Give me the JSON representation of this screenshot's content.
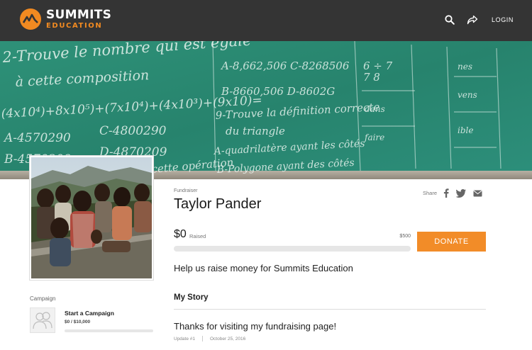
{
  "header": {
    "logo_line1": "SUMMITS",
    "logo_line2": "EDUCATION",
    "login_label": "LOGIN",
    "icons": [
      "search-icon",
      "share-arrow-icon"
    ]
  },
  "colors": {
    "nav_bg": "#343434",
    "brand_orange": "#f18a21",
    "donate_button": "#f28c28",
    "hero_chalkboard": "#2a8a73"
  },
  "hero": {
    "image": "chalkboard with handwritten French math text"
  },
  "sidebar": {
    "section_label": "Campaign",
    "campaign_title": "Start a Campaign",
    "campaign_amount": "$0 / $10,000",
    "campaign_progress": 0
  },
  "fundraiser": {
    "type_label": "Fundraiser",
    "name": "Taylor Pander",
    "share_label": "Share",
    "share_icons": [
      "facebook-icon",
      "twitter-icon",
      "email-icon"
    ],
    "raised_amount": "$0",
    "raised_label": "Raised",
    "goal": "$500",
    "progress": 0,
    "donate_label": "DONATE",
    "tagline": "Help us raise money for Summits Education"
  },
  "story": {
    "heading": "My Story",
    "update_title": "Thanks for visiting my fundraising page!",
    "update_number": "Update #1",
    "update_date": "October 25, 2016"
  }
}
